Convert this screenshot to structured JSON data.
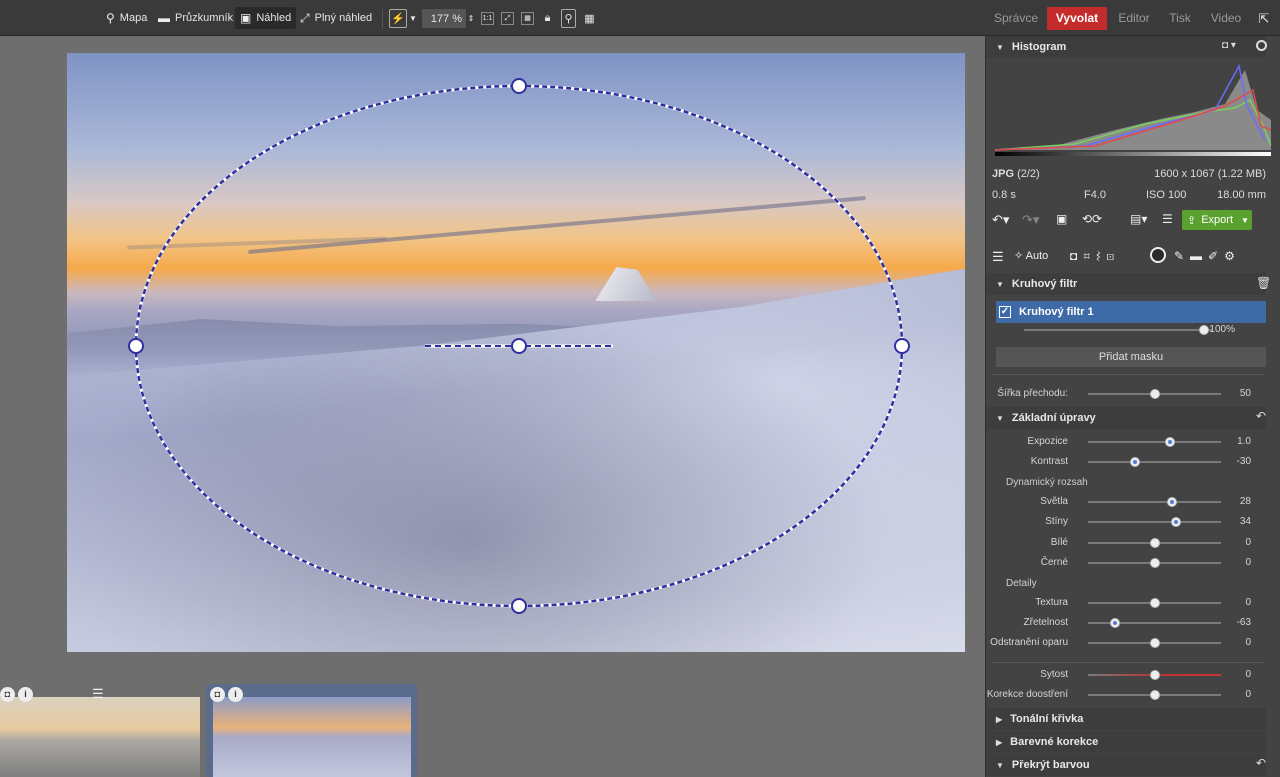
{
  "toolbar": {
    "map": "Mapa",
    "explorer": "Průzkumník",
    "preview": "Náhled",
    "fullscreen": "Plný náhled",
    "zoom": "177 %",
    "one_to_one": "1:1"
  },
  "modes": [
    "Správce",
    "Vyvolat",
    "Editor",
    "Tisk",
    "Video"
  ],
  "active_mode": "Vyvolat",
  "accent": "#c42b2b",
  "panel": {
    "histogram_title": "Histogram",
    "format": "JPG",
    "index": "(2/2)",
    "dimensions": "1600 x 1067 (1.22 MB)",
    "shutter": "0.8 s",
    "aperture": "F4.0",
    "iso": "ISO 100",
    "focal": "18.00 mm",
    "export_label": "Export",
    "auto_label": "Auto",
    "filter_section": "Kruhový filtr",
    "filter_item": "Kruhový filtr 1",
    "filter_opacity": "100%",
    "filter_opacity_level": 0.96,
    "add_mask": "Přidat masku",
    "feather_label": "Šířka přechodu:",
    "feather_value": "50",
    "basic_section": "Základní úpravy",
    "dynamic_range": "Dynamický rozsah",
    "details": "Detaily",
    "tonal_curve": "Tonální křivka",
    "color_corrections": "Barevné korekce",
    "overlay_color": "Překrýt barvou"
  },
  "sliders": [
    {
      "label": "Expozice",
      "value": "1.0",
      "pos": 0.62,
      "active": true
    },
    {
      "label": "Kontrast",
      "value": "-30",
      "pos": 0.35,
      "active": true
    },
    {
      "label": "Světla",
      "value": "28",
      "pos": 0.63,
      "active": true
    },
    {
      "label": "Stíny",
      "value": "34",
      "pos": 0.66,
      "active": true
    },
    {
      "label": "Bílé",
      "value": "0",
      "pos": 0.5,
      "active": false
    },
    {
      "label": "Černé",
      "value": "0",
      "pos": 0.5,
      "active": false
    },
    {
      "label": "Textura",
      "value": "0",
      "pos": 0.5,
      "active": false
    },
    {
      "label": "Zřetelnost",
      "value": "-63",
      "pos": 0.2,
      "active": true
    },
    {
      "label": "Odstranění oparu",
      "value": "0",
      "pos": 0.5,
      "active": false
    },
    {
      "label": "Sytost",
      "value": "0",
      "pos": 0.5,
      "active": false
    },
    {
      "label": "Korekce doostření",
      "value": "0",
      "pos": 0.5,
      "active": false
    }
  ]
}
